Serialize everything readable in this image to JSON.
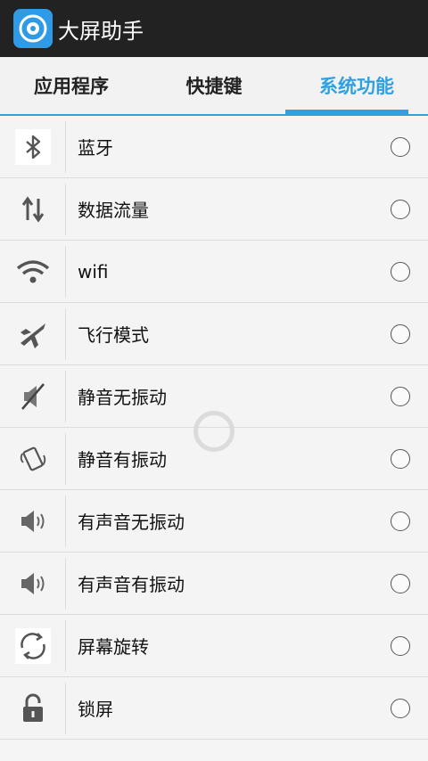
{
  "app": {
    "title": "大屏助手"
  },
  "tabs": [
    {
      "label": "应用程序",
      "active": false
    },
    {
      "label": "快捷键",
      "active": false
    },
    {
      "label": "系统功能",
      "active": true
    }
  ],
  "items": [
    {
      "label": "蓝牙",
      "icon": "bluetooth-icon"
    },
    {
      "label": "数据流量",
      "icon": "data-traffic-icon"
    },
    {
      "label": "wifi",
      "icon": "wifi-icon"
    },
    {
      "label": "飞行模式",
      "icon": "airplane-icon"
    },
    {
      "label": "静音无振动",
      "icon": "mute-icon"
    },
    {
      "label": "静音有振动",
      "icon": "vibrate-icon"
    },
    {
      "label": "有声音无振动",
      "icon": "speaker-icon"
    },
    {
      "label": "有声音有振动",
      "icon": "speaker-icon"
    },
    {
      "label": "屏幕旋转",
      "icon": "rotate-icon"
    },
    {
      "label": "锁屏",
      "icon": "lock-icon"
    }
  ],
  "colors": {
    "accent": "#2fa1de",
    "titlebar": "#222222"
  }
}
